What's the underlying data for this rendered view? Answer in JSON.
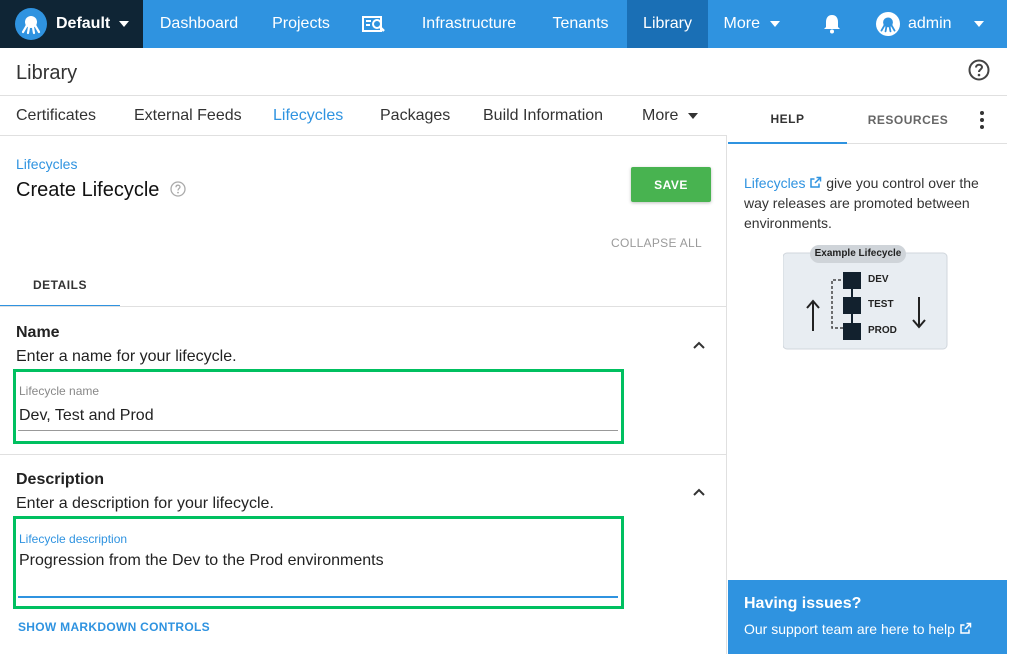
{
  "colors": {
    "brand": "#2f93e0",
    "nav_dark": "#0f2535",
    "active_nav": "#1a6fb5",
    "save": "#48b350",
    "highlight": "#00c060"
  },
  "topnav": {
    "space_name": "Default",
    "items": [
      "Dashboard",
      "Projects",
      "Infrastructure",
      "Tenants",
      "Library",
      "More"
    ],
    "active": "Library",
    "user": "admin",
    "icons": [
      "octopus-logo-icon",
      "search-report-icon",
      "bell-icon",
      "user-avatar-icon"
    ]
  },
  "page": {
    "title": "Library"
  },
  "subtabs": {
    "items": [
      "Certificates",
      "External Feeds",
      "Lifecycles",
      "Packages",
      "Build Information",
      "More"
    ],
    "active": "Lifecycles"
  },
  "form": {
    "breadcrumb": "Lifecycles",
    "title": "Create Lifecycle",
    "save_label": "SAVE",
    "collapse_all": "COLLAPSE ALL",
    "tab_label": "DETAILS",
    "name_section": {
      "heading": "Name",
      "subtitle": "Enter a name for your lifecycle.",
      "label": "Lifecycle name",
      "value": "Dev, Test and Prod"
    },
    "description_section": {
      "heading": "Description",
      "subtitle": "Enter a description for your lifecycle.",
      "label": "Lifecycle description",
      "value": "Progression from the Dev to the Prod environments"
    },
    "markdown_link": "SHOW MARKDOWN CONTROLS"
  },
  "help_panel": {
    "tabs": [
      "HELP",
      "RESOURCES"
    ],
    "active_tab": "HELP",
    "link_text": "Lifecycles",
    "text": "give you control over the way releases are promoted between environments.",
    "diagram": {
      "title": "Example Lifecycle",
      "stages": [
        "DEV",
        "TEST",
        "PROD"
      ]
    },
    "issues_title": "Having issues?",
    "issues_text": "Our support team are here to help"
  }
}
